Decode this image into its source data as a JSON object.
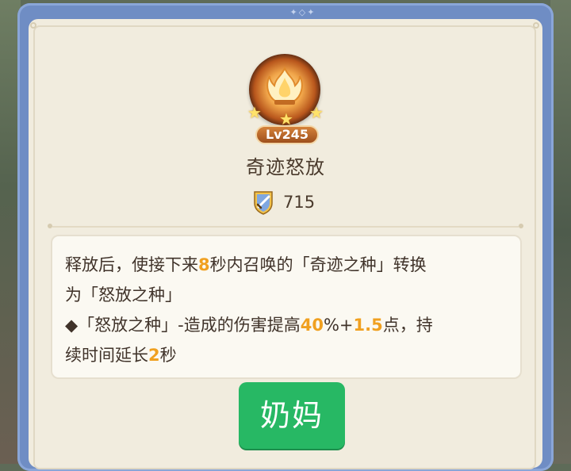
{
  "skill": {
    "level": "Lv245",
    "name": "奇迹怒放",
    "power": "715",
    "stars": 3,
    "max_stars": 3
  },
  "description": {
    "line1": {
      "p1": "释放后，使接下来",
      "v1": "8",
      "p2": "秒内召唤的「奇迹之种」转换"
    },
    "line2": {
      "p1": "为「怒放之种」"
    },
    "line3": {
      "p1": "◆「怒放之种」-造成的伤害提高",
      "v1": "40",
      "p2": "%+",
      "v2": "1.5",
      "p3": "点，持"
    },
    "line4": {
      "p1": "续时间延长",
      "v1": "2",
      "p2": "秒"
    }
  },
  "button": {
    "label": "奶妈"
  },
  "colors": {
    "frame": "#6f8dc4",
    "card": "#f1ecde",
    "highlight": "#f0a020",
    "button": "#27b864",
    "text": "#40332a"
  },
  "icons": {
    "emblem": "flame-lotus-icon",
    "power": "sword-shield-icon",
    "ornament": "diamond-ornament-icon"
  }
}
